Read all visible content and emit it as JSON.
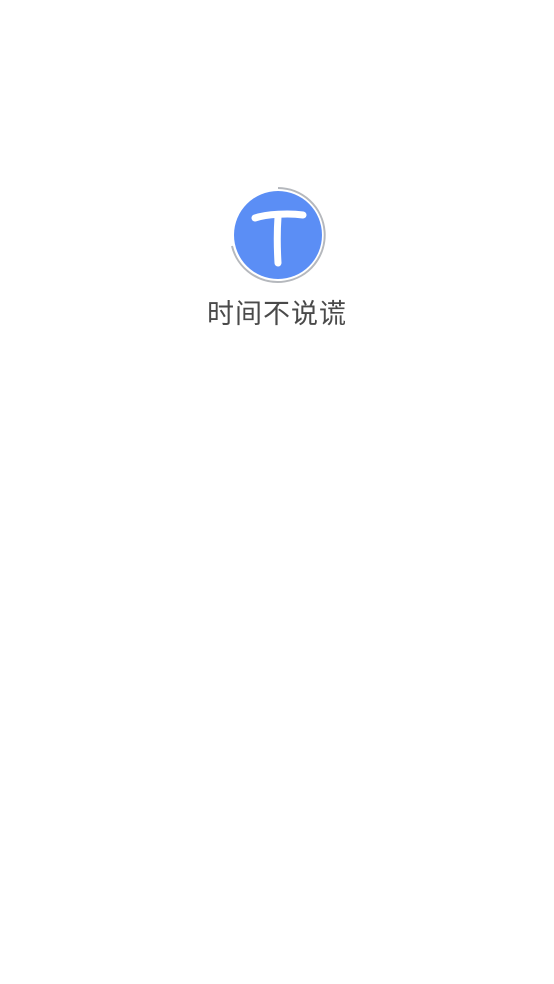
{
  "splash": {
    "logo": {
      "icon": "letter-t-logo-icon",
      "glyph": "T",
      "color": "#5b8ef5",
      "ring_color": "#b5b8bd"
    },
    "app_name": "时间不说谎"
  }
}
